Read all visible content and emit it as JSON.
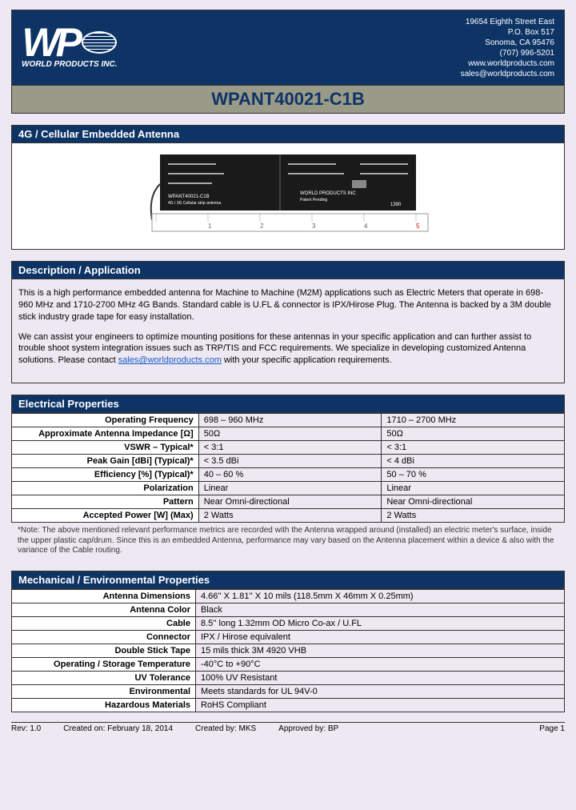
{
  "header": {
    "wp": "WP",
    "company": "WORLD PRODUCTS INC.",
    "contact": {
      "addr1": "19654 Eighth Street East",
      "addr2": "P.O. Box 517",
      "addr3": "Sonoma, CA 95476",
      "phone": "(707) 996-5201",
      "web": "www.worldproducts.com",
      "email": "sales@worldproducts.com"
    }
  },
  "title": "WPANT40021-C1B",
  "subtitle": "4G / Cellular Embedded Antenna",
  "description": {
    "head": "Description / Application",
    "p1": "This is a high performance embedded antenna for Machine to Machine (M2M) applications such as Electric Meters that operate in 698-960 MHz and 1710-2700 MHz 4G Bands. Standard cable is U.FL & connector is IPX/Hirose Plug. The Antenna is backed by a 3M double stick industry grade tape for easy installation.",
    "p2a": "We can assist your engineers to optimize mounting positions for these antennas in your specific application and can further assist to trouble shoot system integration issues such as TRP/TIS and FCC requirements. We specialize in developing customized Antenna solutions. Please contact ",
    "p2link": "sales@worldproducts.com",
    "p2b": " with your specific application requirements."
  },
  "electrical": {
    "head": "Electrical Properties",
    "rows": [
      {
        "label": "Operating Frequency",
        "v1": "698 – 960 MHz",
        "v2": "1710 – 2700 MHz"
      },
      {
        "label": "Approximate Antenna Impedance [Ω]",
        "v1": "50Ω",
        "v2": "50Ω"
      },
      {
        "label": "VSWR – Typical*",
        "v1": "< 3:1",
        "v2": "< 3:1"
      },
      {
        "label": "Peak Gain [dBi] (Typical)*",
        "v1": "< 3.5 dBi",
        "v2": "< 4 dBi"
      },
      {
        "label": "Efficiency [%] (Typical)*",
        "v1": "40 – 60 %",
        "v2": "50 – 70 %"
      },
      {
        "label": "Polarization",
        "v1": "Linear",
        "v2": "Linear"
      },
      {
        "label": "Pattern",
        "v1": "Near Omni-directional",
        "v2": "Near Omni-directional"
      },
      {
        "label": "Accepted Power [W] (Max)",
        "v1": "2 Watts",
        "v2": "2 Watts"
      }
    ],
    "note": "*Note:  The above mentioned relevant performance metrics are recorded with the Antenna wrapped around (installed) an electric meter's surface, inside the upper plastic cap/drum. Since this is an embedded Antenna, performance may vary based on the Antenna placement within a device & also with the variance of the Cable routing."
  },
  "mechanical": {
    "head": "Mechanical / Environmental Properties",
    "rows": [
      {
        "label": "Antenna Dimensions",
        "v": "4.66''  X 1.81''  X 10 mils     (118.5mm X 46mm X 0.25mm)"
      },
      {
        "label": "Antenna Color",
        "v": "Black"
      },
      {
        "label": "Cable",
        "v": "8.5'' long 1.32mm OD Micro Co-ax / U.FL"
      },
      {
        "label": "Connector",
        "v": "IPX / Hirose equivalent"
      },
      {
        "label": "Double Stick Tape",
        "v": "15 mils thick 3M 4920 VHB"
      },
      {
        "label": "Operating / Storage Temperature",
        "v": "-40°C to +90°C"
      },
      {
        "label": "UV Tolerance",
        "v": "100% UV Resistant"
      },
      {
        "label": "Environmental",
        "v": "Meets standards for UL 94V-0"
      },
      {
        "label": "Hazardous Materials",
        "v": "RoHS Compliant"
      }
    ]
  },
  "footer": {
    "rev": "Rev: 1.0",
    "created": "Created on: February 18, 2014",
    "by": "Created by: MKS",
    "approved": "Approved by: BP",
    "page": "Page  1"
  }
}
